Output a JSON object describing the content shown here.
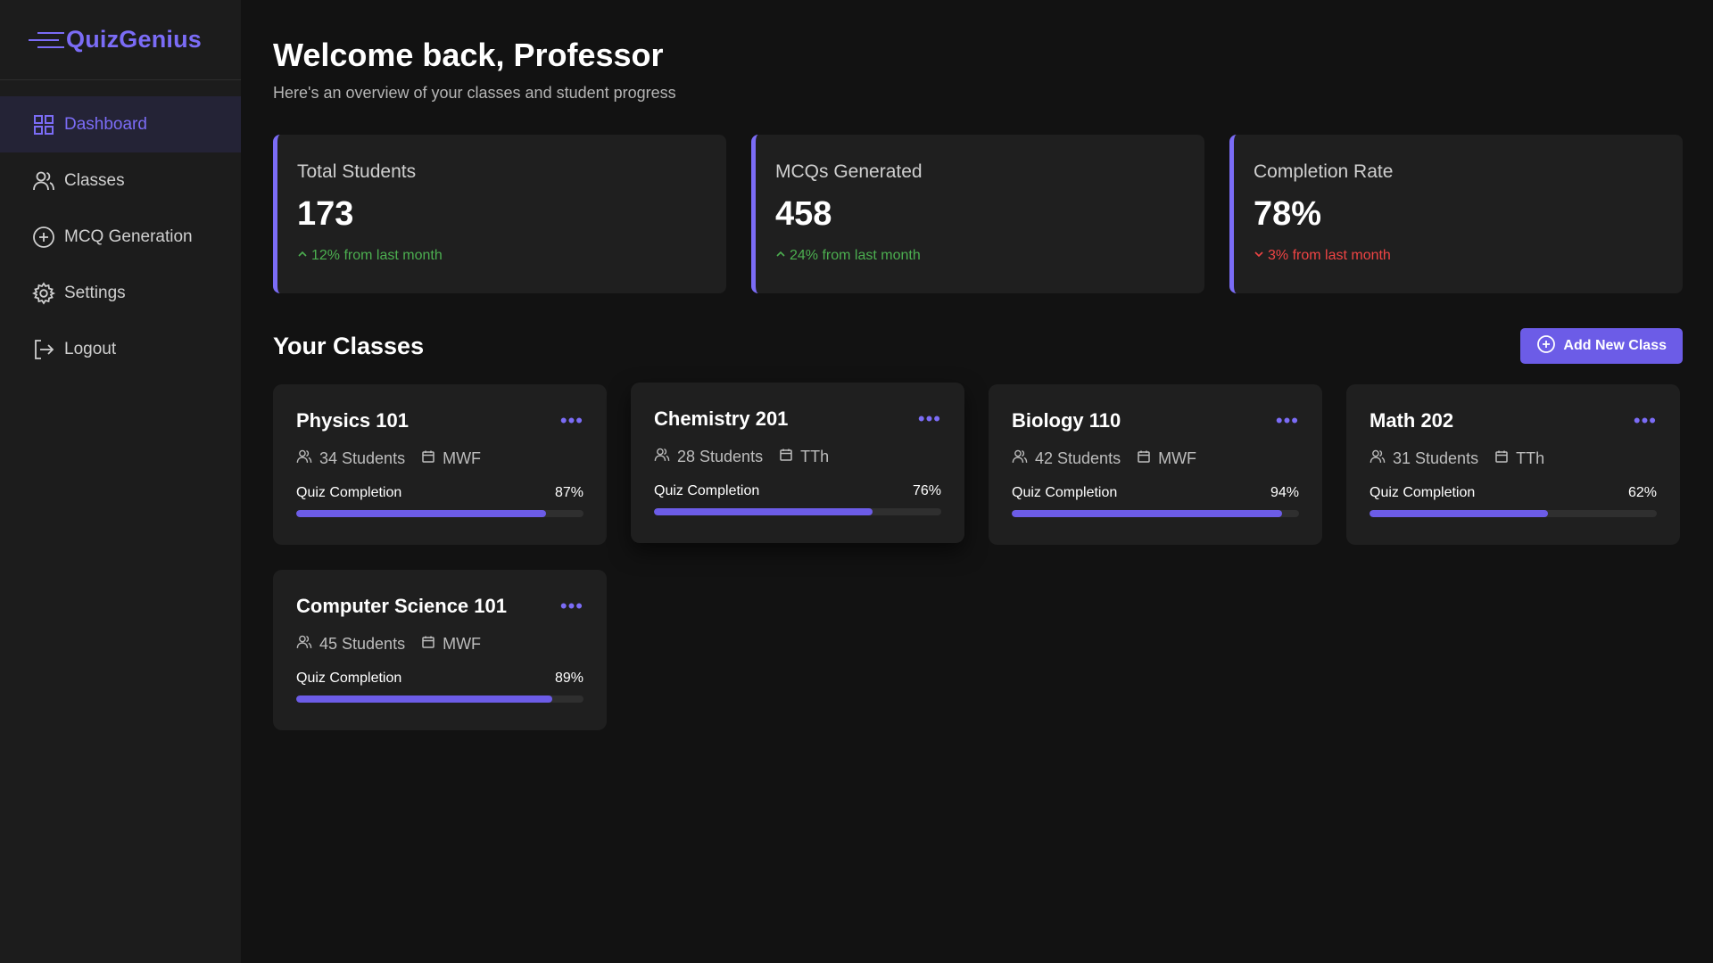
{
  "brand": {
    "name": "QuizGenius",
    "icon": "menu-lines-icon"
  },
  "sidebar": {
    "items": [
      {
        "label": "Dashboard",
        "icon": "grid-icon",
        "active": true
      },
      {
        "label": "Classes",
        "icon": "users-icon",
        "active": false
      },
      {
        "label": "MCQ Generation",
        "icon": "plus-circle-icon",
        "active": false
      },
      {
        "label": "Settings",
        "icon": "gear-icon",
        "active": false
      },
      {
        "label": "Logout",
        "icon": "logout-icon",
        "active": false
      }
    ]
  },
  "header": {
    "title": "Welcome back, Professor",
    "subtitle": "Here's an overview of your classes and student progress"
  },
  "stats": [
    {
      "label": "Total Students",
      "value": "173",
      "delta": "12% from last month",
      "direction": "up"
    },
    {
      "label": "MCQs Generated",
      "value": "458",
      "delta": "24% from last month",
      "direction": "up"
    },
    {
      "label": "Completion Rate",
      "value": "78%",
      "delta": "3% from last month",
      "direction": "down"
    }
  ],
  "classes_section": {
    "title": "Your Classes",
    "add_button_label": "Add New Class"
  },
  "classes": [
    {
      "name": "Physics 101",
      "students": "34 Students",
      "schedule": "MWF",
      "progress_label": "Quiz Completion",
      "completion_text": "87%",
      "completion": 87
    },
    {
      "name": "Chemistry 201",
      "students": "28 Students",
      "schedule": "TTh",
      "progress_label": "Quiz Completion",
      "completion_text": "76%",
      "completion": 76
    },
    {
      "name": "Biology 110",
      "students": "42 Students",
      "schedule": "MWF",
      "progress_label": "Quiz Completion",
      "completion_text": "94%",
      "completion": 94
    },
    {
      "name": "Math 202",
      "students": "31 Students",
      "schedule": "TTh",
      "progress_label": "Quiz Completion",
      "completion_text": "62%",
      "completion": 62
    },
    {
      "name": "Computer Science 101",
      "students": "45 Students",
      "schedule": "MWF",
      "progress_label": "Quiz Completion",
      "completion_text": "89%",
      "completion": 89
    }
  ],
  "colors": {
    "accent": "#7b6cf6",
    "button": "#6c5ce7",
    "up": "#4caf50",
    "down": "#ef4444",
    "background": "#121212",
    "card": "#1f1f1f"
  }
}
